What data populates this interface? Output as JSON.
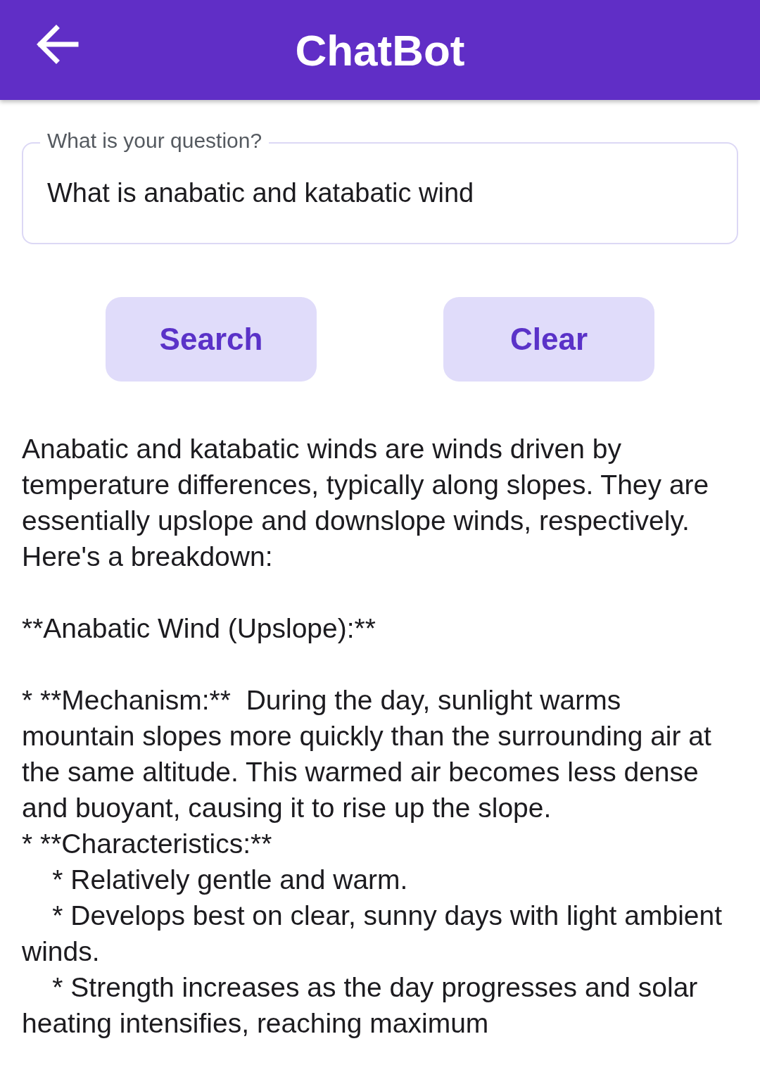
{
  "app_bar": {
    "title": "ChatBot"
  },
  "question_field": {
    "label": "What is your question?",
    "value": "What is anabatic and katabatic wind"
  },
  "buttons": [
    "Search",
    "Clear"
  ],
  "answer": [
    [
      "Anabatic and katabatic winds are winds driven by temperature differences, typically along slopes. They are essentially upslope and downslope winds, respectively.  Here's a breakdown:"
    ],
    [
      "**Anabatic Wind (Upslope):**"
    ],
    [
      "* **Mechanism:**  During the day, sunlight warms mountain slopes more quickly than the surrounding air at the same altitude. This warmed air becomes less dense and buoyant, causing it to rise up the slope.",
      "* **Characteristics:**",
      "    * Relatively gentle and warm.",
      "    * Develops best on clear, sunny days with light ambient winds.",
      "    * Strength increases as the day progresses and solar heating intensifies, reaching maximum"
    ]
  ]
}
